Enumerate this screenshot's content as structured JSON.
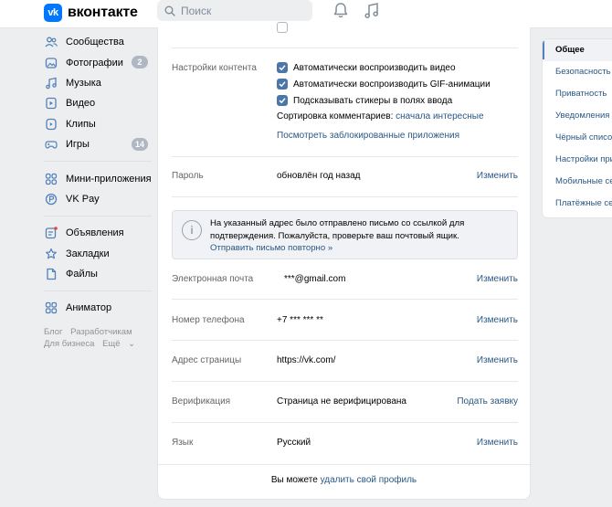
{
  "header": {
    "logo_mark": "vk",
    "logo_text": "вконтакте",
    "search_placeholder": "Поиск",
    "icons": [
      "bell-icon",
      "music-note-icon"
    ]
  },
  "sidebar": {
    "items": [
      {
        "label": "Сообщества",
        "icon": "people-icon"
      },
      {
        "label": "Фотографии",
        "icon": "photo-icon",
        "count": "2"
      },
      {
        "label": "Музыка",
        "icon": "music-icon"
      },
      {
        "label": "Видео",
        "icon": "video-icon"
      },
      {
        "label": "Клипы",
        "icon": "clips-icon"
      },
      {
        "label": "Игры",
        "icon": "gamepad-icon",
        "count": "14"
      },
      {
        "label": "Мини-приложения",
        "icon": "apps-icon"
      },
      {
        "label": "VK Pay",
        "icon": "vkpay-icon"
      },
      {
        "label": "Объявления",
        "icon": "ads-icon"
      },
      {
        "label": "Закладки",
        "icon": "star-icon"
      },
      {
        "label": "Файлы",
        "icon": "file-icon"
      },
      {
        "label": "Аниматор",
        "icon": "animator-icon"
      }
    ],
    "footer": {
      "blog": "Блог",
      "devs": "Разработчикам",
      "business": "Для бизнеса",
      "more": "Ещё"
    }
  },
  "settings": {
    "content_label": "Настройки контента",
    "autoplay_video": "Автоматически воспроизводить видео",
    "autoplay_gif": "Автоматически воспроизводить GIF-анимации",
    "suggest_stickers": "Подсказывать стикеры в полях ввода",
    "comments_sort_label": "Сортировка комментариев:",
    "comments_sort_value": "сначала интересные",
    "blocked_apps": "Посмотреть заблокированные приложения",
    "password_label": "Пароль",
    "password_value": "обновлён год назад",
    "change": "Изменить",
    "notice_text": "На указанный адрес было отправлено письмо со ссылкой для подтверждения. Пожалуйста, проверьте ваш почтовый ящик.",
    "notice_link": "Отправить письмо повторно »",
    "email_label": "Электронная почта",
    "email_value": "***@gmail.com",
    "phone_label": "Номер телефона",
    "phone_value": "+7 *** *** ** ",
    "address_label": "Адрес страницы",
    "address_value": "https://vk.com/",
    "verify_label": "Верификация",
    "verify_value": "Страница не верифицирована",
    "verify_action": "Подать заявку",
    "lang_label": "Язык",
    "lang_value": "Русский",
    "footer_prefix": "Вы можете",
    "footer_link": "удалить свой профиль"
  },
  "right_menu": {
    "items": [
      "Общее",
      "Безопасность",
      "Приватность",
      "Уведомления",
      "Чёрный список",
      "Настройки приложений",
      "Мобильные сервисы",
      "Платёжные сервисы"
    ]
  },
  "colors": {
    "accent": "#0077ff",
    "link": "#2a5885",
    "checkbox": "#4a76a8",
    "background": "#edeef0"
  }
}
